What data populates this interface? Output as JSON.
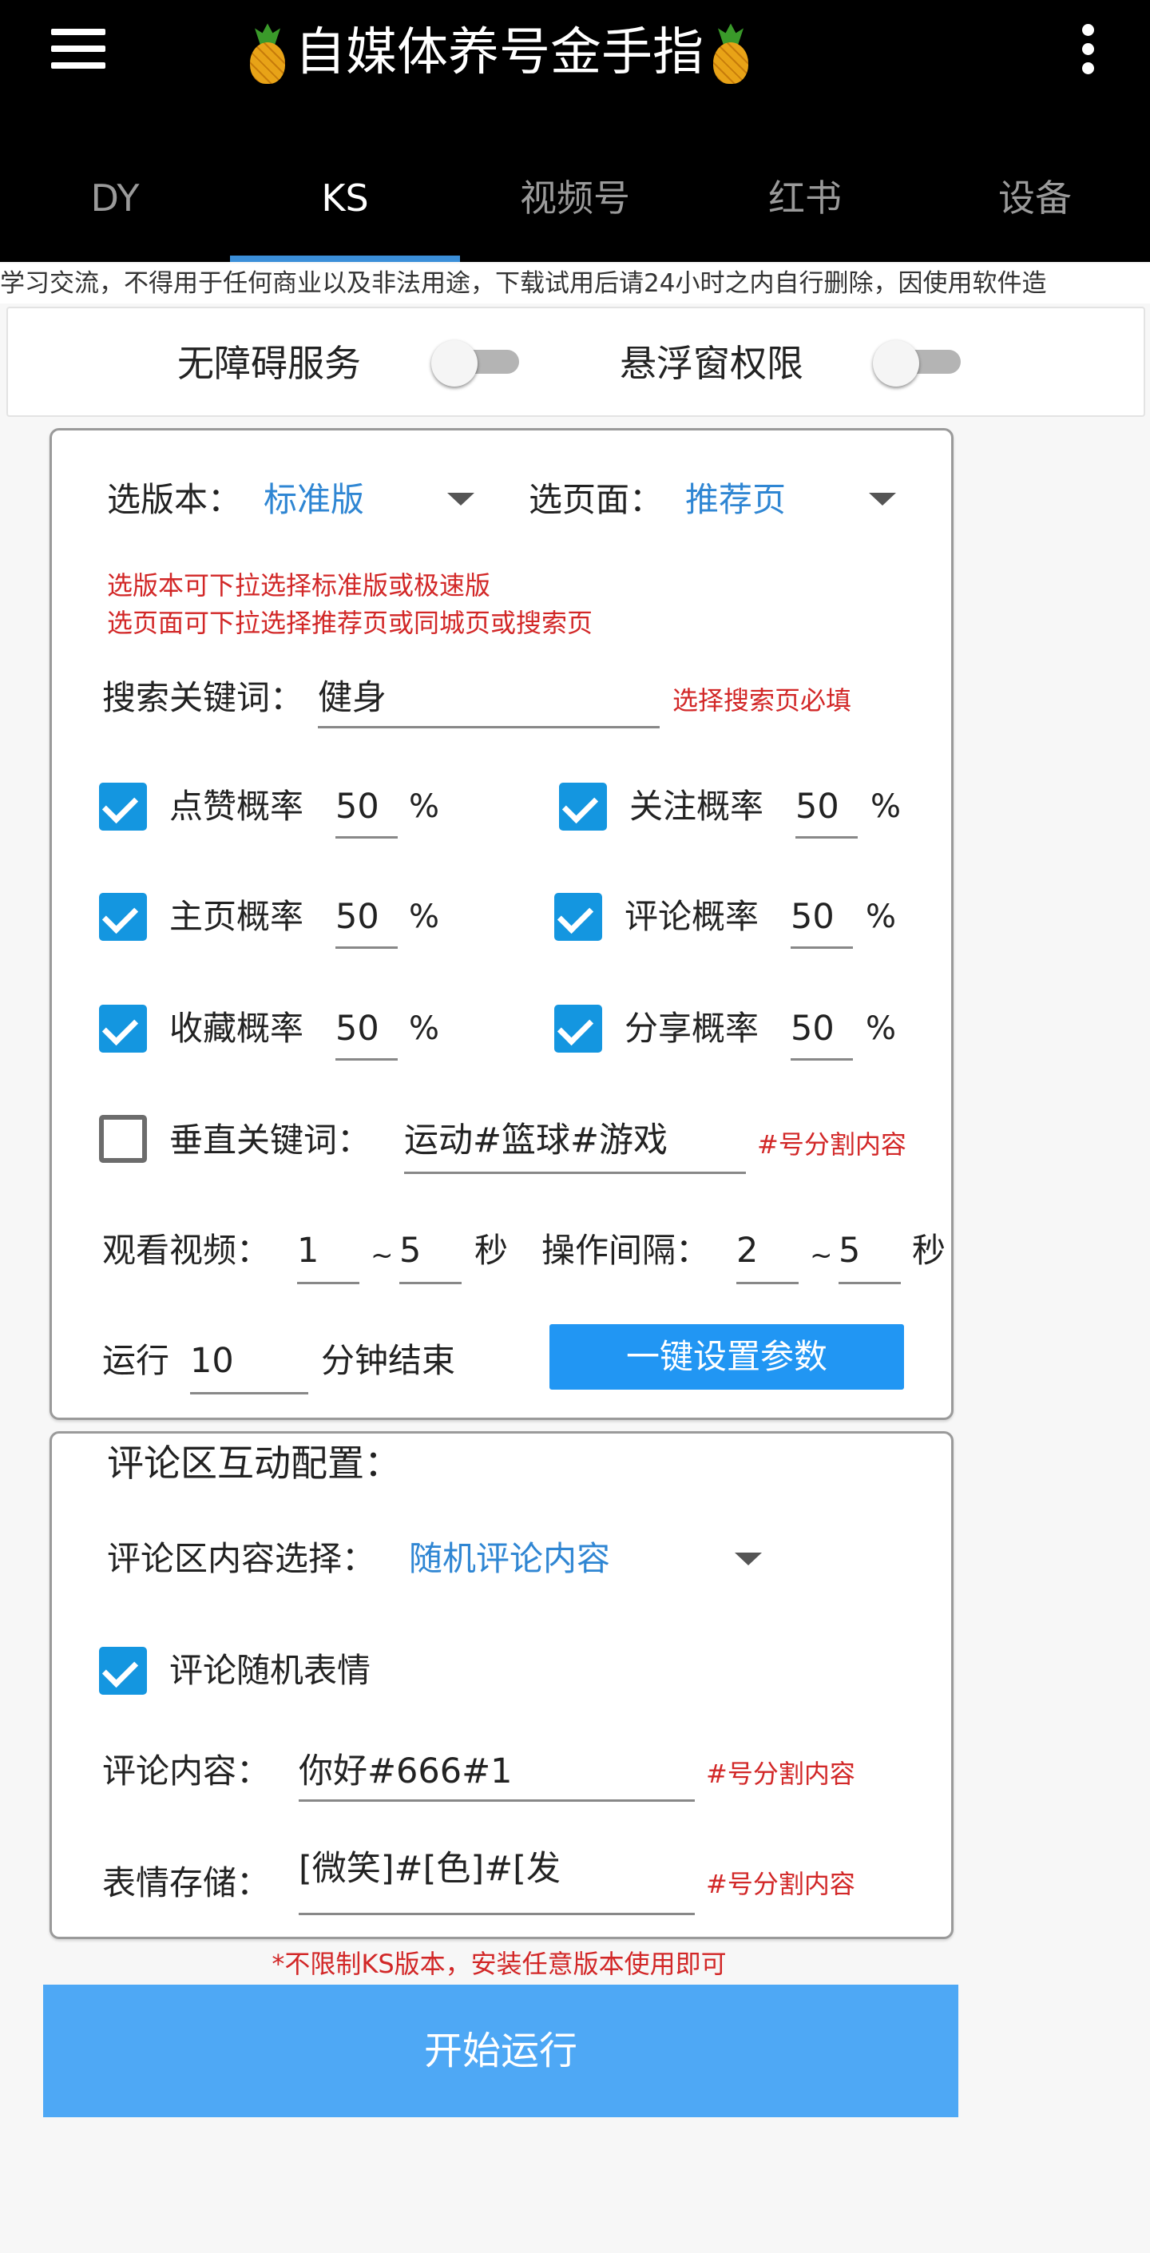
{
  "header": {
    "title": "自媒体养号金手指",
    "menu_icon": "hamburger-menu-icon",
    "title_icon": "pineapple-icon",
    "more_icon": "more-vertical-icon"
  },
  "tabs": [
    {
      "label": "DY"
    },
    {
      "label": "KS"
    },
    {
      "label": "视频号"
    },
    {
      "label": "红书"
    },
    {
      "label": "设备"
    }
  ],
  "active_tab": "KS",
  "marquee": "学习交流，不得用于任何商业以及非法用途，下载试用后请24小时之内自行删除，因使用软件造",
  "permissions": {
    "accessibility_label": "无障碍服务",
    "accessibility_on": false,
    "overlay_label": "悬浮窗权限",
    "overlay_on": false
  },
  "settings": {
    "version_label": "选版本：",
    "version_value": "标准版",
    "page_label": "选页面：",
    "page_value": "推荐页",
    "hint_line1": "选版本可下拉选择标准版或极速版",
    "hint_line2": "选页面可下拉选择推荐页或同城页或搜索页",
    "keyword_label": "搜索关键词：",
    "keyword_value": "健身",
    "keyword_hint": "选择搜索页必填",
    "percent_sign": "%",
    "probabilities": [
      {
        "label": "点赞概率",
        "value": "50",
        "checked": true
      },
      {
        "label": "关注概率",
        "value": "50",
        "checked": true
      },
      {
        "label": "主页概率",
        "value": "50",
        "checked": true
      },
      {
        "label": "评论概率",
        "value": "50",
        "checked": true
      },
      {
        "label": "收藏概率",
        "value": "50",
        "checked": true
      },
      {
        "label": "分享概率",
        "value": "50",
        "checked": true
      }
    ],
    "vertical_keyword_label": "垂直关键词：",
    "vertical_keyword_value": "运动#篮球#游戏",
    "vertical_keyword_checked": false,
    "vertical_keyword_hint": "#号分割内容",
    "watch_label": "观看视频：",
    "watch_min": "1",
    "watch_tilde": "~",
    "watch_max": "5",
    "watch_unit": "秒",
    "interval_label": "操作间隔：",
    "interval_min": "2",
    "interval_tilde": "~",
    "interval_max": "5",
    "interval_unit": "秒",
    "run_label": "运行",
    "run_value": "10",
    "run_unit": "分钟结束",
    "preset_button": "一键设置参数"
  },
  "comments": {
    "section_title": "评论区互动配置：",
    "content_select_label": "评论区内容选择：",
    "content_select_value": "随机评论内容",
    "random_emoji_label": "评论随机表情",
    "random_emoji_checked": true,
    "content_label": "评论内容：",
    "content_value": "你好#666#1",
    "content_hint": "#号分割内容",
    "emoji_label": "表情存储：",
    "emoji_value": "[微笑]#[色]#[发",
    "emoji_hint": "#号分割内容"
  },
  "footer": {
    "version_note": "*不限制KS版本，安装任意版本使用即可",
    "start_button": "开始运行"
  },
  "colors": {
    "accent": "#2196f3",
    "start_button": "#4ea8f5",
    "hint_red": "#d22727",
    "checkbox": "#1496e0",
    "appbar": "#000000"
  }
}
